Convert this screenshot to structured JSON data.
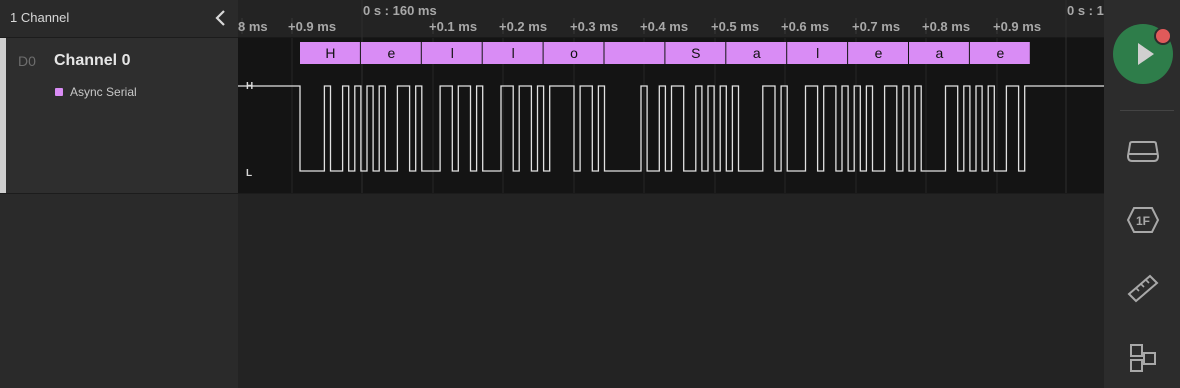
{
  "panel": {
    "channel_count": "1 Channel",
    "channel": {
      "id": "D0",
      "name": "Channel 0"
    },
    "analyzer": {
      "label": "Async Serial",
      "color": "#d98cf5"
    }
  },
  "timeline": {
    "main_ticks": [
      "0 s : 160 ms",
      "0 s : 1"
    ],
    "ticks": [
      "8 ms",
      "+0.9 ms",
      "+0.1 ms",
      "+0.2 ms",
      "+0.3 ms",
      "+0.4 ms",
      "+0.5 ms",
      "+0.6 ms",
      "+0.7 ms",
      "+0.8 ms",
      "+0.9 ms"
    ]
  },
  "waveform": {
    "high_label": "H",
    "low_label": "L",
    "frames": [
      "H",
      "e",
      "l",
      "l",
      "o",
      "",
      "S",
      "a",
      "l",
      "e",
      "a",
      "e"
    ],
    "frame_color": "#d98cf5",
    "bytes": [
      72,
      101,
      108,
      108,
      111,
      32,
      83,
      97,
      108,
      101,
      97,
      101
    ]
  },
  "toolbar": {
    "run_icon": "play-icon",
    "tools": [
      "device-icon",
      "analyzer-icon",
      "measure-icon",
      "extensions-icon"
    ]
  }
}
